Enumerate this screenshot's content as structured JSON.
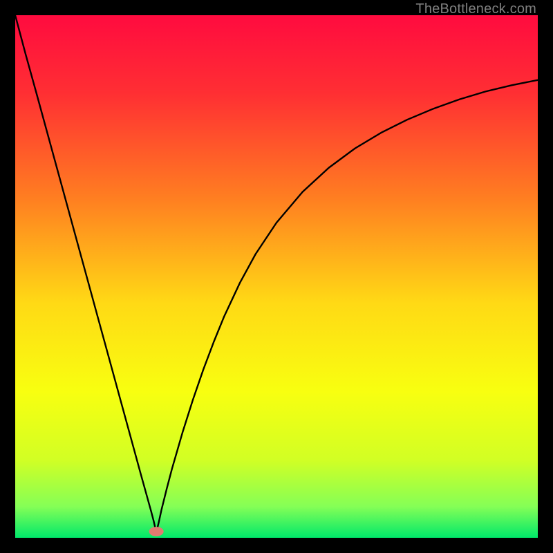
{
  "watermark": "TheBottleneck.com",
  "chart_data": {
    "type": "line",
    "title": "",
    "xlabel": "",
    "ylabel": "",
    "xlim": [
      0,
      100
    ],
    "ylim": [
      0,
      100
    ],
    "grid": false,
    "legend": false,
    "background_gradient_stops": [
      {
        "offset": 0.0,
        "color": "#ff0b3f"
      },
      {
        "offset": 0.15,
        "color": "#ff2f33"
      },
      {
        "offset": 0.35,
        "color": "#ff7e21"
      },
      {
        "offset": 0.55,
        "color": "#ffd915"
      },
      {
        "offset": 0.72,
        "color": "#f8ff10"
      },
      {
        "offset": 0.85,
        "color": "#d2ff24"
      },
      {
        "offset": 0.94,
        "color": "#85ff56"
      },
      {
        "offset": 1.0,
        "color": "#00e86a"
      }
    ],
    "vertex": {
      "x": 27,
      "y": 1
    },
    "marker": {
      "x": 27,
      "y": 1.2,
      "color": "#e07b70",
      "rx": 1.4,
      "ry": 0.9
    },
    "series": [
      {
        "name": "curve",
        "color": "#000000",
        "x": [
          0,
          2,
          4,
          6,
          8,
          10,
          12,
          14,
          16,
          18,
          20,
          22,
          24,
          25,
          26,
          26.5,
          27,
          27.5,
          28,
          29,
          30,
          32,
          34,
          36,
          38,
          40,
          43,
          46,
          50,
          55,
          60,
          65,
          70,
          75,
          80,
          85,
          90,
          95,
          100
        ],
        "y": [
          100,
          92.5,
          85.3,
          78,
          70.7,
          63.4,
          56.1,
          48.8,
          41.5,
          34.2,
          26.9,
          19.6,
          12.3,
          8.7,
          5.1,
          3.2,
          1,
          3.1,
          5.4,
          9.4,
          13.2,
          20.1,
          26.4,
          32.2,
          37.5,
          42.4,
          48.8,
          54.3,
          60.3,
          66.2,
          70.8,
          74.5,
          77.5,
          80.0,
          82.1,
          83.9,
          85.4,
          86.6,
          87.6
        ]
      }
    ]
  }
}
